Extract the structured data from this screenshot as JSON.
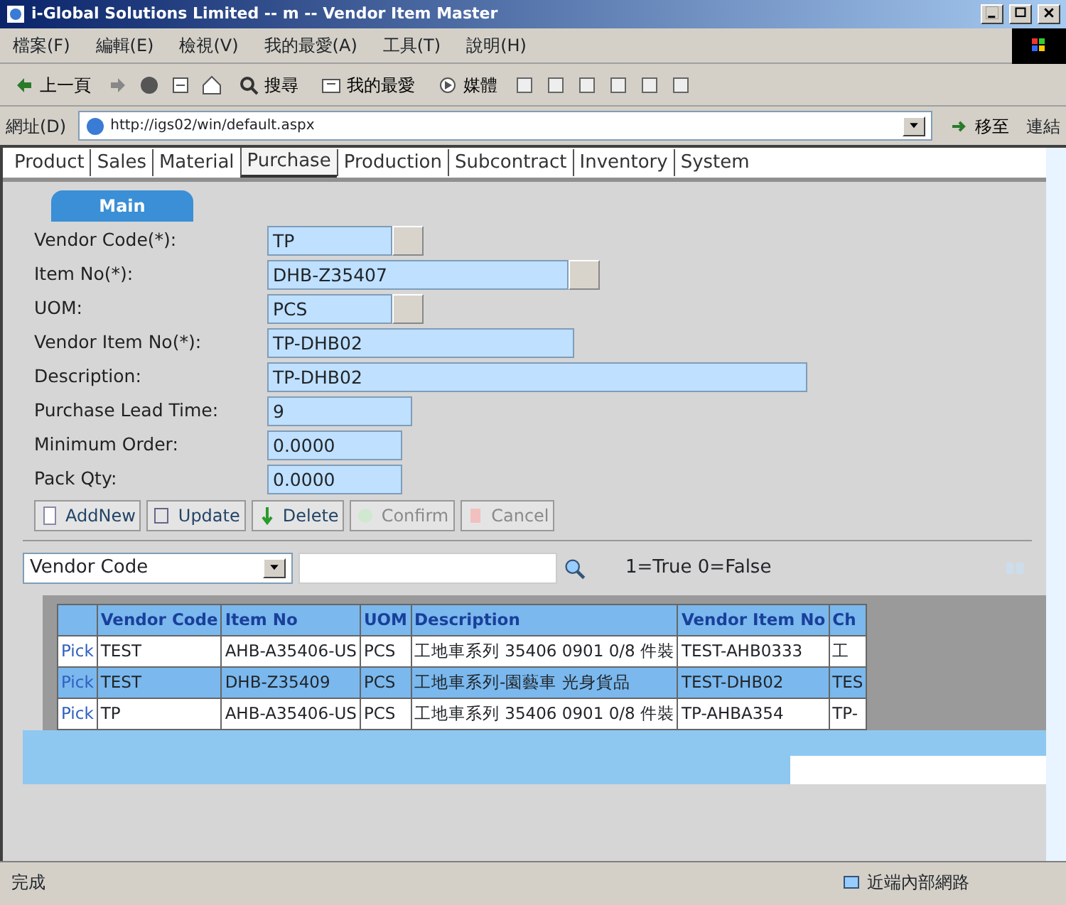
{
  "window": {
    "title": "i-Global Solutions Limited -- m -- Vendor Item Master"
  },
  "menu": [
    "檔案(F)",
    "編輯(E)",
    "檢視(V)",
    "我的最愛(A)",
    "工具(T)",
    "說明(H)"
  ],
  "toolbar": [
    {
      "kind": "back",
      "label": "上一頁"
    },
    {
      "kind": "search",
      "label": "搜尋"
    },
    {
      "kind": "favorites",
      "label": "我的最愛"
    },
    {
      "kind": "media",
      "label": "媒體"
    }
  ],
  "address": {
    "label": "網址(D)",
    "url": "http://igs02/win/default.aspx",
    "go": "移至",
    "links": "連結"
  },
  "tabs": [
    {
      "label": "Product",
      "selected": false
    },
    {
      "label": "Sales",
      "selected": false
    },
    {
      "label": "Material",
      "selected": false
    },
    {
      "label": "Purchase",
      "selected": true
    },
    {
      "label": "Production",
      "selected": false
    },
    {
      "label": "Subcontract",
      "selected": false
    },
    {
      "label": "Inventory",
      "selected": false
    },
    {
      "label": "System",
      "selected": false
    }
  ],
  "section_tab": "Main",
  "fields": [
    {
      "label": "Vendor Code(*):",
      "value": "TP",
      "kind": "lookup"
    },
    {
      "label": "Item No(*):",
      "value": "DHB-Z35407",
      "kind": "lookup"
    },
    {
      "label": "UOM:",
      "value": "PCS",
      "kind": "lookup"
    },
    {
      "label": "Vendor Item No(*):",
      "value": "TP-DHB02",
      "kind": "text"
    },
    {
      "label": "Description:",
      "value": "TP-DHB02",
      "kind": "text"
    },
    {
      "label": "Purchase Lead Time:",
      "value": "9",
      "kind": "text"
    },
    {
      "label": "Minimum Order:",
      "value": "0.0000",
      "kind": "text"
    },
    {
      "label": "Pack Qty:",
      "value": "0.0000",
      "kind": "text"
    }
  ],
  "buttons": [
    {
      "label": "AddNew",
      "kind": "add",
      "disabled": false
    },
    {
      "label": "Update",
      "kind": "update",
      "disabled": false
    },
    {
      "label": "Delete",
      "kind": "delete",
      "disabled": false
    },
    {
      "label": "Confirm",
      "kind": "confirm",
      "disabled": true
    },
    {
      "label": "Cancel",
      "kind": "cancel",
      "disabled": true
    }
  ],
  "filter": {
    "field": "Vendor Code",
    "hint": "1=True 0=False"
  },
  "table": {
    "columns": [
      "",
      "Vendor Code",
      "Item No",
      "UOM",
      "Description",
      "Vendor Item No",
      "Ch"
    ],
    "rows": [
      {
        "selected": false,
        "cells": [
          "Pick",
          "TEST",
          "AHB-A35406-US",
          "PCS",
          "工地車系列 35406 0901 0/8 件裝",
          "TEST-AHB0333",
          "工"
        ]
      },
      {
        "selected": true,
        "cells": [
          "Pick",
          "TEST",
          "DHB-Z35409",
          "PCS",
          "工地車系列-園藝車 光身貨品",
          "TEST-DHB02",
          "TES"
        ]
      },
      {
        "selected": false,
        "cells": [
          "Pick",
          "TP",
          "AHB-A35406-US",
          "PCS",
          "工地車系列 35406 0901 0/8 件裝",
          "TP-AHBA354",
          "TP-"
        ]
      }
    ]
  },
  "status_bar": {
    "text": "完成",
    "zone": "近端內部網路"
  }
}
